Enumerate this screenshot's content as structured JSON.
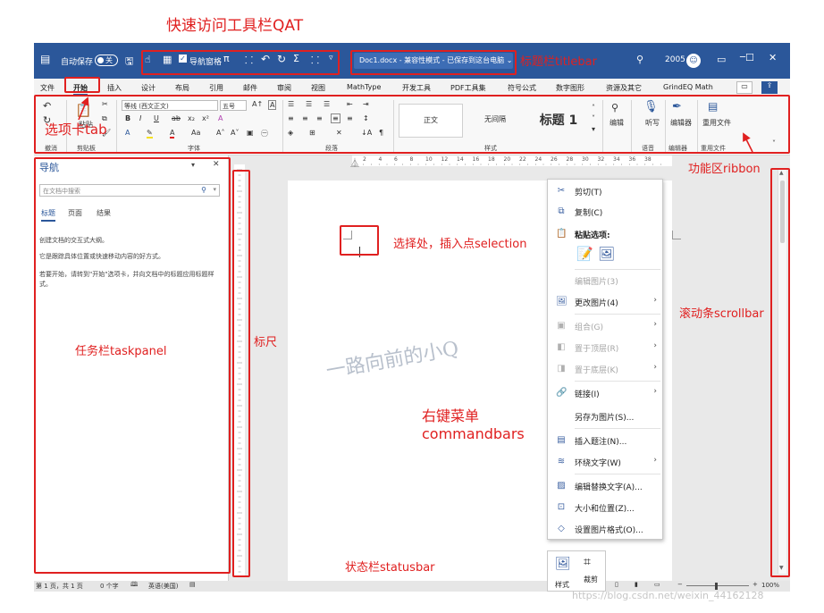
{
  "annotations": {
    "qat": "快速访问工具栏QAT",
    "titlebar": "标题栏titlebar",
    "tab": "选项卡tab",
    "ribbon": "功能区ribbon",
    "selection": "选择处，插入点selection",
    "ruler": "标尺",
    "taskpanel": "任务栏taskpanel",
    "scrollbar": "滚动条scrollbar",
    "commandbars_line1": "右键菜单",
    "commandbars_line2": "commandbars",
    "statusbar": "状态栏statusbar"
  },
  "titlebar": {
    "autosave_label": "自动保存",
    "autosave_state": "关",
    "nav_pane_label": "导航窗格",
    "document_title": "Doc1.docx - 兼容性模式 - 已保存到这台电脑",
    "dropdown": "⌄",
    "time": "2005",
    "minimize": "─",
    "maximize": "☐",
    "close": "✕"
  },
  "tabs": [
    "文件",
    "开始",
    "插入",
    "设计",
    "布局",
    "引用",
    "邮件",
    "审阅",
    "视图",
    "MathType",
    "开发工具",
    "PDF工具集",
    "符号公式",
    "数字图形",
    "资源及其它",
    "GrindEQ Math"
  ],
  "ribbon": {
    "font_name": "等线 (西文正文)",
    "font_size": "五号",
    "paste_label": "粘贴",
    "groups": [
      "撤消",
      "剪贴板",
      "字体",
      "段落",
      "样式",
      "语音",
      "编辑器",
      "重用文件"
    ],
    "style_normal": "正文",
    "style_nospacing": "无间隔",
    "style_heading1": "标题 1",
    "editing_label": "编辑",
    "dictate_label": "听写",
    "editor_label": "编辑器",
    "reuse_label": "重用文件"
  },
  "ruler_numbers": [
    "2",
    "4",
    "6",
    "8",
    "10",
    "12",
    "14",
    "16",
    "18",
    "20",
    "22",
    "24",
    "26",
    "28",
    "30",
    "32",
    "34",
    "36",
    "38"
  ],
  "navpane": {
    "title": "导航",
    "search_placeholder": "在文档中搜索",
    "tabs": [
      "标题",
      "页面",
      "结果"
    ],
    "line1": "创建文档的交互式大纲。",
    "line2": "它是跟踪具体位置或快速移动内容的好方式。",
    "line3": "若要开始，请转到\"开始\"选项卡，并向文档中的标题应用标题样式。"
  },
  "document": {
    "watermark_text": "一路向前的小Q"
  },
  "context_menu": {
    "items": [
      {
        "label": "剪切(T)",
        "icon": "✂"
      },
      {
        "label": "复制(C)",
        "icon": "⧉"
      },
      {
        "label": "粘贴选项:",
        "icon": "📋"
      },
      {
        "label": "编辑图片(3)",
        "icon": ""
      },
      {
        "label": "更改图片(4)",
        "icon": "🖼"
      },
      {
        "label": "组合(G)",
        "icon": "▣"
      },
      {
        "label": "置于顶层(R)",
        "icon": "◧"
      },
      {
        "label": "置于底层(K)",
        "icon": "◨"
      },
      {
        "label": "链接(I)",
        "icon": "🔗"
      },
      {
        "label": "另存为图片(S)...",
        "icon": ""
      },
      {
        "label": "插入题注(N)...",
        "icon": "▤"
      },
      {
        "label": "环绕文字(W)",
        "icon": "≋"
      },
      {
        "label": "编辑替换文字(A)...",
        "icon": "▨"
      },
      {
        "label": "大小和位置(Z)...",
        "icon": "⊡"
      },
      {
        "label": "设置图片格式(O)...",
        "icon": "◇"
      }
    ],
    "arrow": "›"
  },
  "mini_toolbar": {
    "style_label": "样式",
    "crop_label": "裁剪"
  },
  "statusbar": {
    "page_info": "第 1 页，共 1 页",
    "word_count": "0 个字",
    "language": "英语(美国)",
    "zoom": "100%",
    "watermark_url": "https://blog.csdn.net/weixin_44162128"
  },
  "colors": {
    "accent_blue": "#2b579a",
    "annotation_red": "#e02020"
  }
}
